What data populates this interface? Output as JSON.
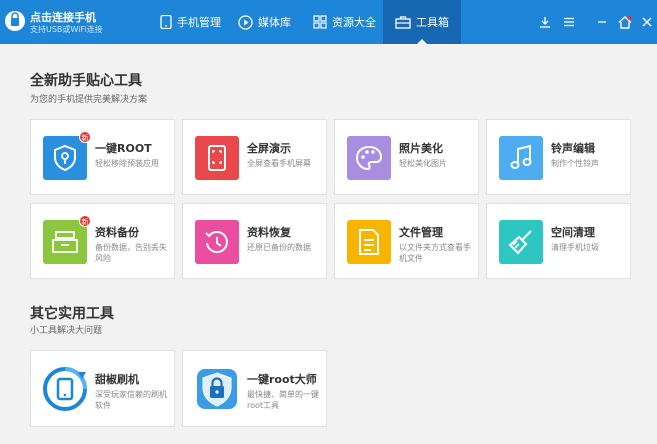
{
  "app": {
    "title": "点击连接手机",
    "subtitle": "支持USB或WiFi连接"
  },
  "nav": [
    {
      "label": "手机管理",
      "icon": "phone-icon"
    },
    {
      "label": "媒体库",
      "icon": "play-icon"
    },
    {
      "label": "资源大全",
      "icon": "grid-icon"
    },
    {
      "label": "工具箱",
      "icon": "toolbox-icon",
      "active": true
    }
  ],
  "window_controls": [
    "download-icon",
    "menu-icon",
    "minimize-icon",
    "home-icon",
    "close-icon"
  ],
  "section1": {
    "title": "全新助手贴心工具",
    "subtitle": "为您的手机提供完美解决方案"
  },
  "tools": [
    {
      "title": "一键ROOT",
      "desc": "轻松移除预装应用",
      "icon": "shield-key-icon",
      "color": "#2b8fe0",
      "badge": "新"
    },
    {
      "title": "全屏演示",
      "desc": "全屏查看手机屏幕",
      "icon": "fullscreen-phone-icon",
      "color": "#e8474c"
    },
    {
      "title": "照片美化",
      "desc": "轻松美化图片",
      "icon": "palette-icon",
      "color": "#a98de0"
    },
    {
      "title": "铃声编辑",
      "desc": "制作个性铃声",
      "icon": "music-note-icon",
      "color": "#4dadf0"
    },
    {
      "title": "资料备份",
      "desc": "备份数据，告别丢失风险",
      "icon": "archive-box-icon",
      "color": "#8cc63f",
      "badge": "新"
    },
    {
      "title": "资料恢复",
      "desc": "还原已备份的数据",
      "icon": "restore-clock-icon",
      "color": "#e94ea0"
    },
    {
      "title": "文件管理",
      "desc": "以文件夹方式查看手机文件",
      "icon": "document-icon",
      "color": "#f7b500"
    },
    {
      "title": "空间清理",
      "desc": "清理手机垃圾",
      "icon": "broom-icon",
      "color": "#2dc6c0"
    }
  ],
  "section2": {
    "title": "其它实用工具",
    "subtitle": "小工具解决大问题"
  },
  "other_tools": [
    {
      "title": "甜椒刷机",
      "desc": "深受玩家信赖的刷机软件",
      "icon": "refresh-phone-icon"
    },
    {
      "title": "一键root大师",
      "desc": "最快捷、简单的一键root工具",
      "icon": "lock-shield-icon"
    }
  ]
}
